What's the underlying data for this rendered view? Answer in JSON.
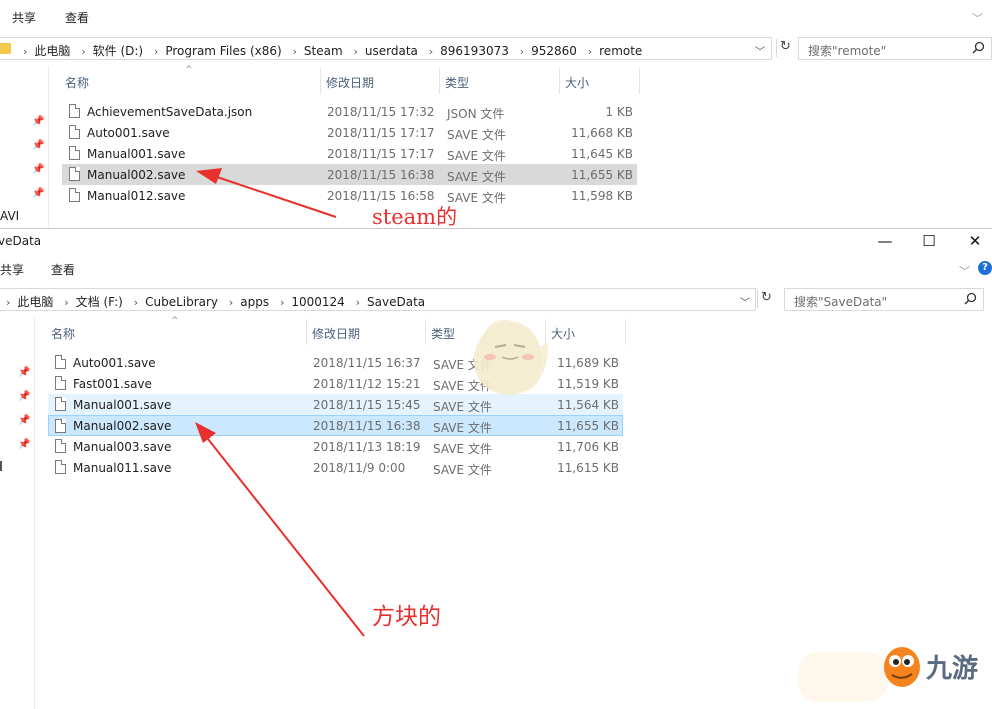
{
  "window1": {
    "ribbon": {
      "share": "共享",
      "view": "查看"
    },
    "breadcrumb": [
      "此电脑",
      "软件 (D:)",
      "Program Files (x86)",
      "Steam",
      "userdata",
      "896193073",
      "952860",
      "remote"
    ],
    "search_placeholder": "搜索\"remote\"",
    "columns": {
      "name": "名称",
      "date": "修改日期",
      "type": "类型",
      "size": "大小"
    },
    "sidebar_fragment": "AVI",
    "files": [
      {
        "name": "AchievementSaveData.json",
        "date": "2018/11/15 17:32",
        "type": "JSON 文件",
        "size": "1 KB"
      },
      {
        "name": "Auto001.save",
        "date": "2018/11/15 17:17",
        "type": "SAVE 文件",
        "size": "11,668 KB"
      },
      {
        "name": "Manual001.save",
        "date": "2018/11/15 17:17",
        "type": "SAVE 文件",
        "size": "11,645 KB"
      },
      {
        "name": "Manual002.save",
        "date": "2018/11/15 16:38",
        "type": "SAVE 文件",
        "size": "11,655 KB"
      },
      {
        "name": "Manual012.save",
        "date": "2018/11/15 16:58",
        "type": "SAVE 文件",
        "size": "11,598 KB"
      }
    ],
    "annotation": "steam的"
  },
  "window2": {
    "title": "veData",
    "ribbon": {
      "share": "共享",
      "view": "查看"
    },
    "breadcrumb": [
      "此电脑",
      "文档 (F:)",
      "CubeLibrary",
      "apps",
      "1000124",
      "SaveData"
    ],
    "search_placeholder": "搜索\"SaveData\"",
    "columns": {
      "name": "名称",
      "date": "修改日期",
      "type": "类型",
      "size": "大小"
    },
    "files": [
      {
        "name": "Auto001.save",
        "date": "2018/11/15 16:37",
        "type": "SAVE 文件",
        "size": "11,689 KB"
      },
      {
        "name": "Fast001.save",
        "date": "2018/11/12 15:21",
        "type": "SAVE 文件",
        "size": "11,519 KB"
      },
      {
        "name": "Manual001.save",
        "date": "2018/11/15 15:45",
        "type": "SAVE 文件",
        "size": "11,564 KB"
      },
      {
        "name": "Manual002.save",
        "date": "2018/11/15 16:38",
        "type": "SAVE 文件",
        "size": "11,655 KB"
      },
      {
        "name": "Manual003.save",
        "date": "2018/11/13 18:19",
        "type": "SAVE 文件",
        "size": "11,706 KB"
      },
      {
        "name": "Manual011.save",
        "date": "2018/11/9 0:00",
        "type": "SAVE 文件",
        "size": "11,615 KB"
      }
    ],
    "annotation": "方块的"
  },
  "watermark": {
    "brand": "九游"
  },
  "colors": {
    "annotation_red": "#e8302f",
    "selection_blue": "#cce8ff",
    "hover_blue": "#e5f3ff",
    "selection_grey": "#d9d9d9"
  }
}
